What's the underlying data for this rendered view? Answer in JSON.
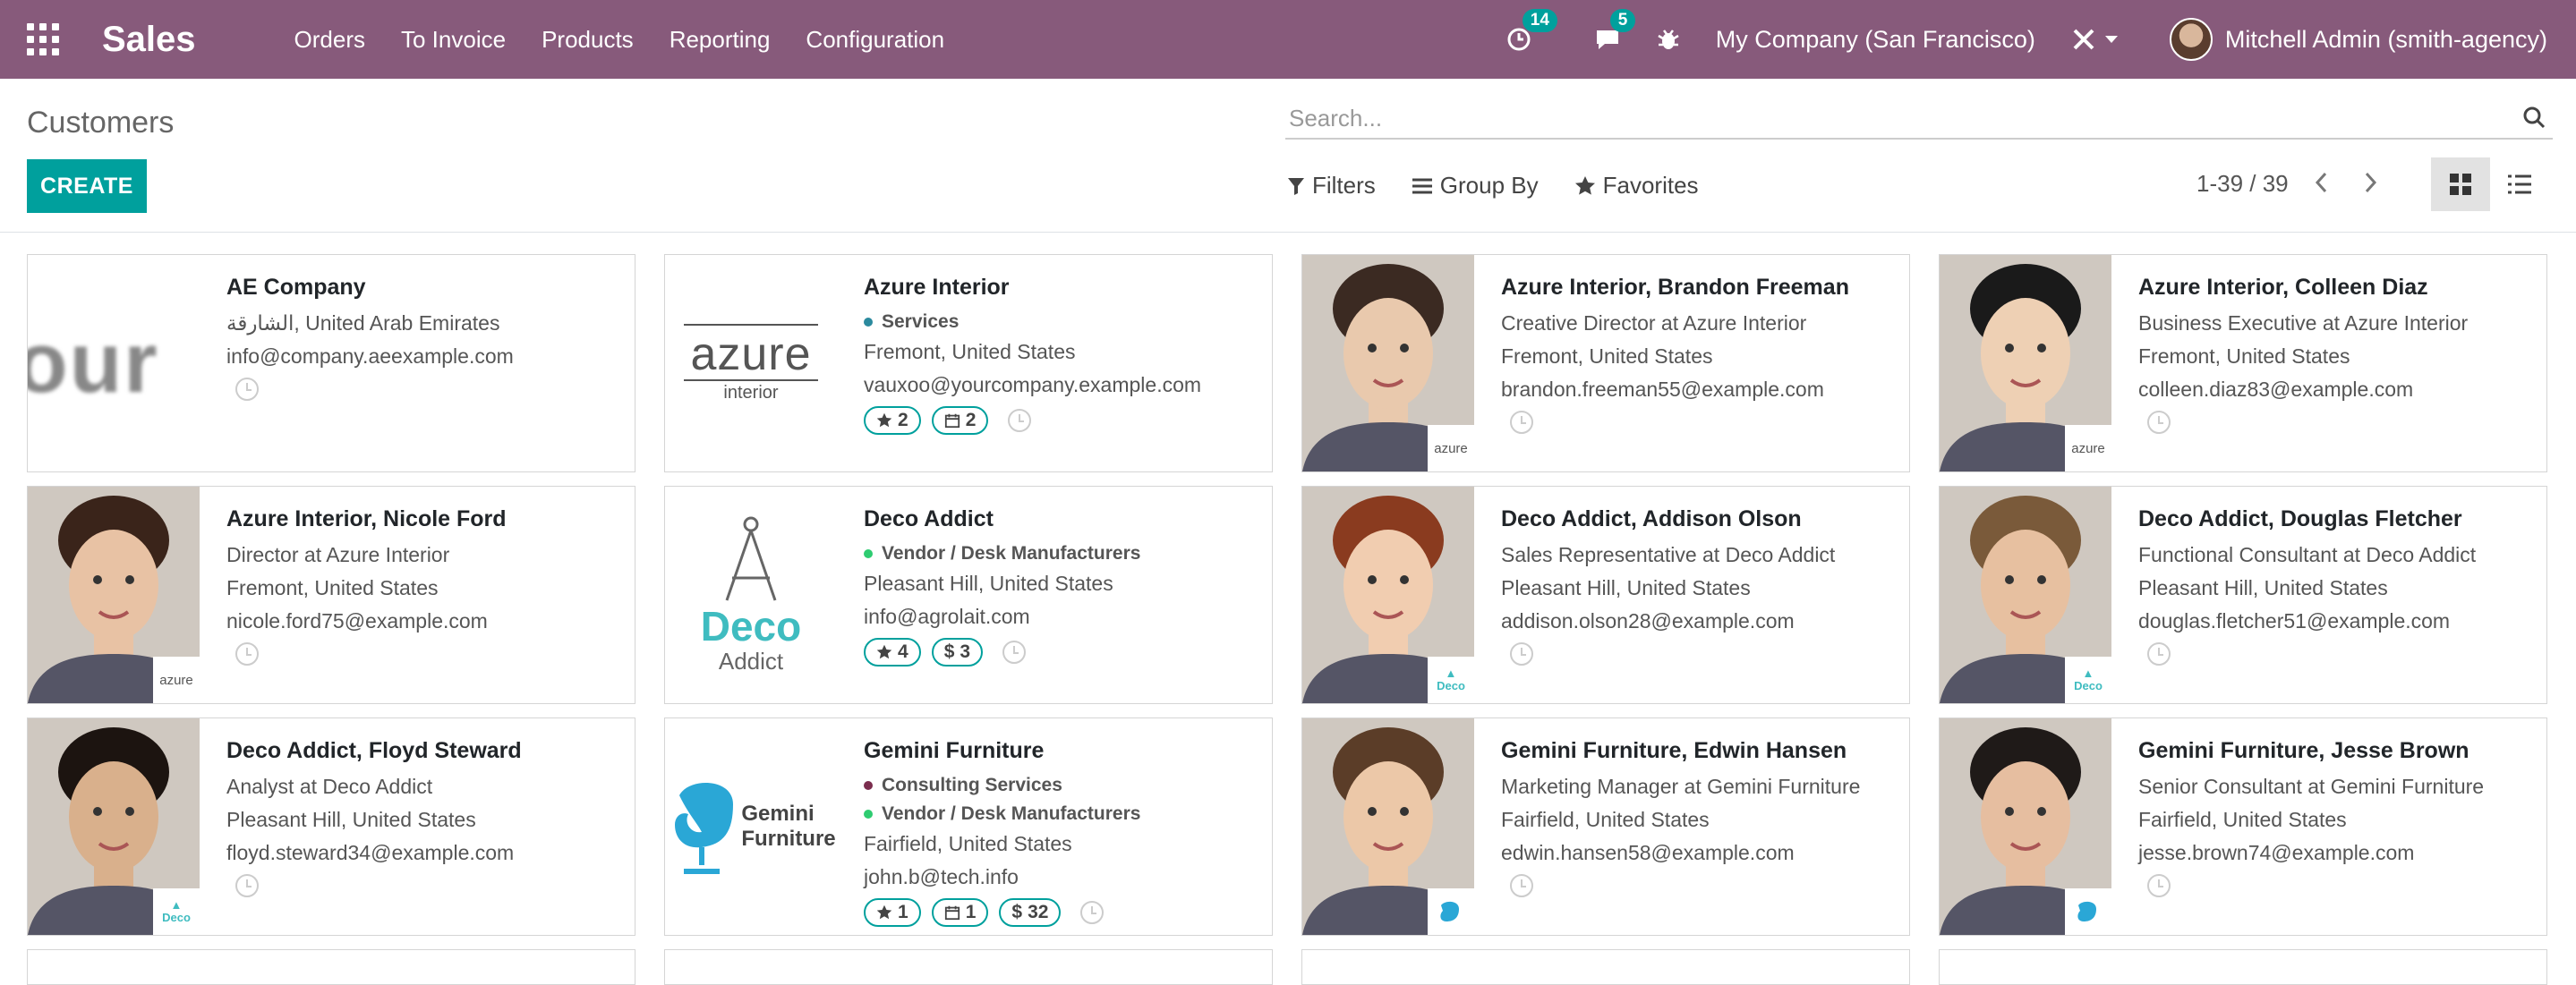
{
  "app": {
    "title": "Sales",
    "menu": [
      "Orders",
      "To Invoice",
      "Products",
      "Reporting",
      "Configuration"
    ],
    "activity_count": "14",
    "message_count": "5",
    "company": "My Company (San Francisco)",
    "user": "Mitchell Admin (smith-agency)"
  },
  "control": {
    "title": "Customers",
    "search_placeholder": "Search...",
    "create_label": "CREATE",
    "filters_label": "Filters",
    "groupby_label": "Group By",
    "favorites_label": "Favorites",
    "pager": "1-39 / 39"
  },
  "colors": {
    "navbar": "#875A7B",
    "accent": "#00A09D"
  },
  "cards": [
    {
      "name": "AE Company",
      "lines": [
        "الشارقة, United Arab Emirates",
        "info@company.aeexample.com"
      ],
      "cats": [],
      "chips": [],
      "image": "company-logo-partial"
    },
    {
      "name": "Azure Interior",
      "lines": [
        "Fremont, United States",
        "vauxoo@yourcompany.example.com"
      ],
      "cats": [
        {
          "label": "Services",
          "color": "#2b8a9e"
        }
      ],
      "chips": [
        {
          "icon": "star",
          "text": "2"
        },
        {
          "icon": "calendar",
          "text": "2"
        }
      ],
      "image": "azure-logo",
      "logo_text": "azure",
      "logo_sub": "interior"
    },
    {
      "name": "Azure Interior, Brandon Freeman",
      "lines": [
        "Creative Director at Azure Interior",
        "Fremont, United States",
        "brandon.freeman55@example.com"
      ],
      "cats": [],
      "chips": [],
      "image": "person-photo",
      "badge": "azure"
    },
    {
      "name": "Azure Interior, Colleen Diaz",
      "lines": [
        "Business Executive at Azure Interior",
        "Fremont, United States",
        "colleen.diaz83@example.com"
      ],
      "cats": [],
      "chips": [],
      "image": "person-photo",
      "badge": "azure"
    },
    {
      "name": "Azure Interior, Nicole Ford",
      "lines": [
        "Director at Azure Interior",
        "Fremont, United States",
        "nicole.ford75@example.com"
      ],
      "cats": [],
      "chips": [],
      "image": "person-photo",
      "badge": "azure"
    },
    {
      "name": "Deco Addict",
      "lines": [
        "Pleasant Hill, United States",
        "info@agrolait.com"
      ],
      "cats": [
        {
          "label": "Vendor / Desk Manufacturers",
          "color": "#2ecc71"
        }
      ],
      "chips": [
        {
          "icon": "star",
          "text": "4"
        },
        {
          "icon": "dollar",
          "text": "3"
        }
      ],
      "image": "deco-logo",
      "logo_text": "Deco",
      "logo_sub": "Addict"
    },
    {
      "name": "Deco Addict, Addison Olson",
      "lines": [
        "Sales Representative at Deco Addict",
        "Pleasant Hill, United States",
        "addison.olson28@example.com"
      ],
      "cats": [],
      "chips": [],
      "image": "person-photo",
      "badge": "Deco"
    },
    {
      "name": "Deco Addict, Douglas Fletcher",
      "lines": [
        "Functional Consultant at Deco Addict",
        "Pleasant Hill, United States",
        "douglas.fletcher51@example.com"
      ],
      "cats": [],
      "chips": [],
      "image": "person-photo",
      "badge": "Deco"
    },
    {
      "name": "Deco Addict, Floyd Steward",
      "lines": [
        "Analyst at Deco Addict",
        "Pleasant Hill, United States",
        "floyd.steward34@example.com"
      ],
      "cats": [],
      "chips": [],
      "image": "person-photo",
      "badge": "Deco"
    },
    {
      "name": "Gemini Furniture",
      "lines": [
        "Fairfield, United States",
        "john.b@tech.info"
      ],
      "cats": [
        {
          "label": "Consulting Services",
          "color": "#7b2d4e"
        },
        {
          "label": "Vendor / Desk Manufacturers",
          "color": "#2ecc71"
        }
      ],
      "chips": [
        {
          "icon": "star",
          "text": "1"
        },
        {
          "icon": "calendar",
          "text": "1"
        },
        {
          "icon": "dollar",
          "text": "32"
        }
      ],
      "image": "gemini-logo",
      "logo_text": "Gemini",
      "logo_sub": "Furniture"
    },
    {
      "name": "Gemini Furniture, Edwin Hansen",
      "lines": [
        "Marketing Manager at Gemini Furniture",
        "Fairfield, United States",
        "edwin.hansen58@example.com"
      ],
      "cats": [],
      "chips": [],
      "image": "person-photo",
      "badge": "gemini"
    },
    {
      "name": "Gemini Furniture, Jesse Brown",
      "lines": [
        "Senior Consultant at Gemini Furniture",
        "Fairfield, United States",
        "jesse.brown74@example.com"
      ],
      "cats": [],
      "chips": [],
      "image": "person-photo",
      "badge": "gemini"
    }
  ]
}
